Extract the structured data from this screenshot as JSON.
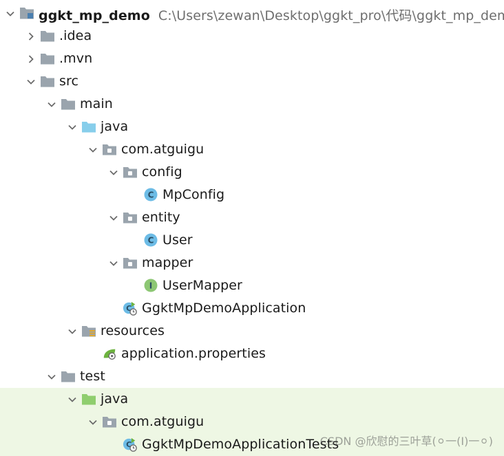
{
  "project": {
    "name": "ggkt_mp_demo",
    "path": "C:\\Users\\zewan\\Desktop\\ggkt_pro\\代码\\ggkt_mp_demo"
  },
  "tree": [
    {
      "label": "ggkt_mp_demo",
      "path": "C:\\Users\\zewan\\Desktop\\ggkt_pro\\代码\\ggkt_mp_demo",
      "depth": 0,
      "arrow": "down",
      "icon": "module-icon",
      "bold": true
    },
    {
      "label": ".idea",
      "depth": 1,
      "arrow": "right",
      "icon": "folder-icon"
    },
    {
      "label": ".mvn",
      "depth": 1,
      "arrow": "right",
      "icon": "folder-icon"
    },
    {
      "label": "src",
      "depth": 1,
      "arrow": "down",
      "icon": "folder-icon"
    },
    {
      "label": "main",
      "depth": 2,
      "arrow": "down",
      "icon": "folder-icon"
    },
    {
      "label": "java",
      "depth": 3,
      "arrow": "down",
      "icon": "source-folder-icon"
    },
    {
      "label": "com.atguigu",
      "depth": 4,
      "arrow": "down",
      "icon": "package-icon"
    },
    {
      "label": "config",
      "depth": 5,
      "arrow": "down",
      "icon": "package-icon"
    },
    {
      "label": "MpConfig",
      "depth": 6,
      "arrow": "none",
      "icon": "class-icon"
    },
    {
      "label": "entity",
      "depth": 5,
      "arrow": "down",
      "icon": "package-icon"
    },
    {
      "label": "User",
      "depth": 6,
      "arrow": "none",
      "icon": "class-icon"
    },
    {
      "label": "mapper",
      "depth": 5,
      "arrow": "down",
      "icon": "package-icon"
    },
    {
      "label": "UserMapper",
      "depth": 6,
      "arrow": "none",
      "icon": "interface-icon"
    },
    {
      "label": "GgktMpDemoApplication",
      "depth": 5,
      "arrow": "none",
      "icon": "spring-boot-class-icon"
    },
    {
      "label": "resources",
      "depth": 3,
      "arrow": "down",
      "icon": "resources-folder-icon"
    },
    {
      "label": "application.properties",
      "depth": 4,
      "arrow": "none",
      "icon": "spring-properties-icon"
    },
    {
      "label": "test",
      "depth": 2,
      "arrow": "down",
      "icon": "folder-icon"
    },
    {
      "label": "java",
      "depth": 3,
      "arrow": "down",
      "icon": "test-source-folder-icon",
      "test": true
    },
    {
      "label": "com.atguigu",
      "depth": 4,
      "arrow": "down",
      "icon": "package-icon",
      "test": true
    },
    {
      "label": "GgktMpDemoApplicationTests",
      "depth": 5,
      "arrow": "none",
      "icon": "spring-boot-test-class-icon",
      "test": true
    }
  ],
  "watermark": "CSDN @欣慰的三叶草(⚪一(Ⅰ)一⚪)",
  "colors": {
    "folder": "#9aa4ad",
    "source_folder": "#87ceeb",
    "test_folder": "#8fce6e",
    "class": "#6dbce6",
    "interface": "#8dc774",
    "spring": "#6db33f",
    "test_row_bg": "#eef7e4"
  }
}
